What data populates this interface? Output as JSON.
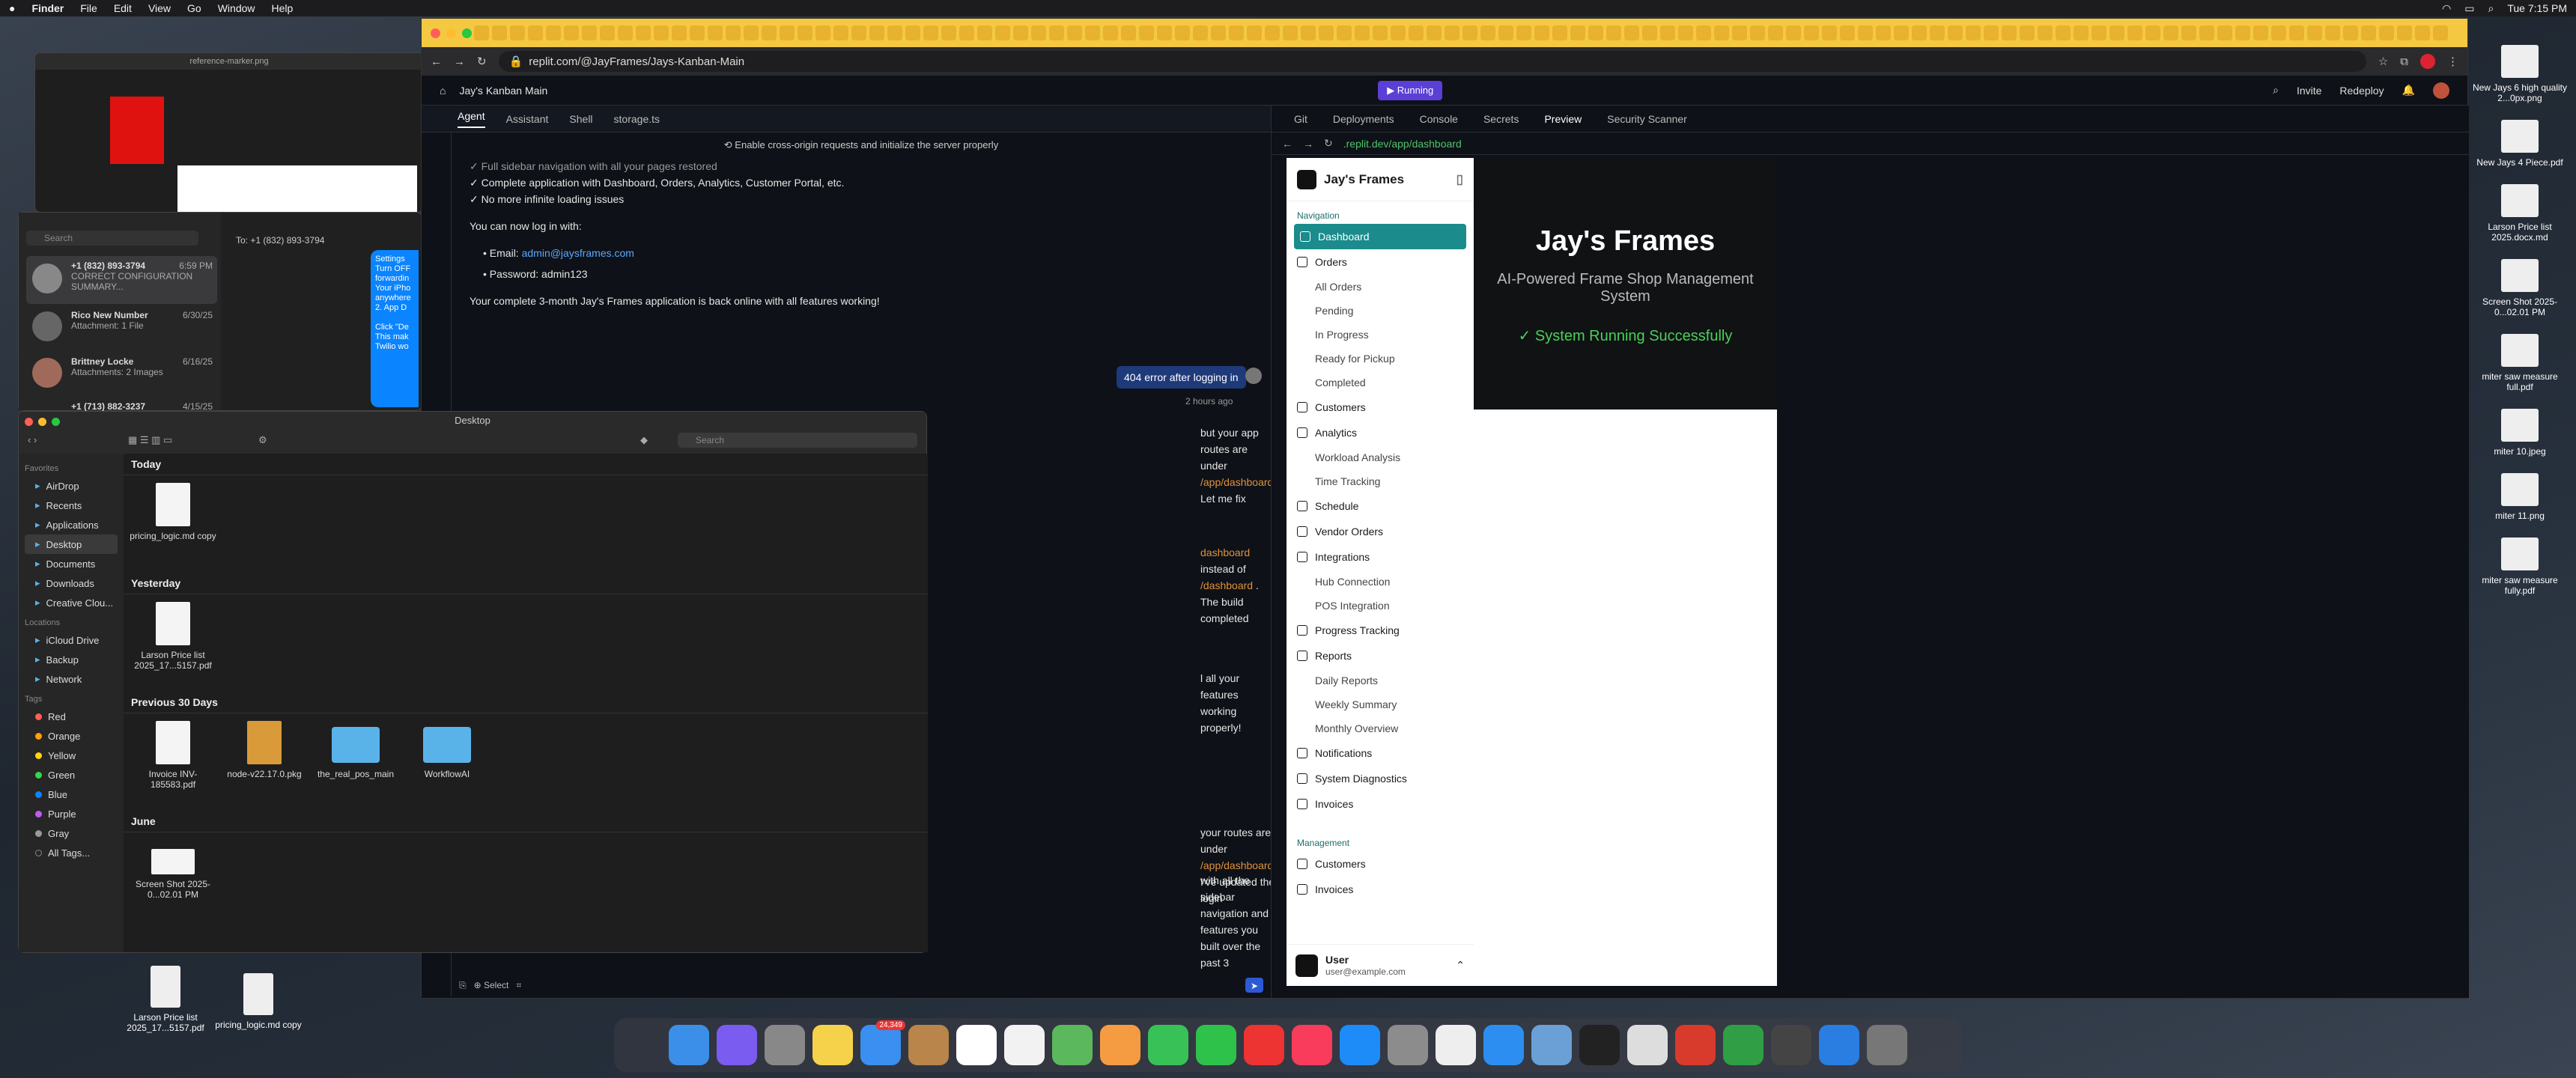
{
  "menubar": {
    "app": "Finder",
    "items": [
      "File",
      "Edit",
      "View",
      "Go",
      "Window",
      "Help"
    ],
    "clock": "Tue 7:15 PM"
  },
  "browser": {
    "url": "replit.com/@JayFrames/Jays-Kanban-Main",
    "repl_title": "Jay's Kanban Main",
    "status": "Running",
    "header_actions": [
      "Invite",
      "Redeploy"
    ],
    "left_tabs": [
      "Agent",
      "Assistant",
      "Shell",
      "storage.ts"
    ],
    "right_tabs": [
      "Git",
      "Deployments",
      "Console",
      "Secrets",
      "Preview",
      "Security Scanner"
    ],
    "preview_url": ".replit.dev/app/dashboard",
    "tab_count": "24,349"
  },
  "chat": {
    "checkpoint": "Enable cross-origin requests and initialize the server properly",
    "lines": [
      "✓ Full sidebar navigation with all your pages restored",
      "✓ Complete application with Dashboard, Orders, Analytics, Customer Portal, etc.",
      "✓ No more infinite loading issues",
      "You can now log in with:",
      "Password: admin123",
      "Your complete 3-month Jay's Frames application is back online with all features working!"
    ],
    "email_label": "Email:",
    "email": "admin@jaysframes.com",
    "user_msg": "404 error after logging in",
    "user_msg_time": "2 hours ago",
    "frag1": "but your app routes are under",
    "frag1_code": "/app/dashboard",
    "frag1_end": ". Let me fix",
    "frag2_code1": "dashboard",
    "frag2_mid": "instead of",
    "frag2_code2": "/dashboard",
    "frag2_end": ". The build completed",
    "frag3": "l all your features working properly!",
    "frag4": "your routes are under",
    "frag4_code": "/app/dashboard",
    "frag4_end": ". I've updated the login",
    "frag5": "with all the sidebar navigation and features you built over the past 3",
    "select_label": "Select"
  },
  "app": {
    "brand": "Jay's Frames",
    "hero_title": "Jay's Frames",
    "hero_sub": "AI-Powered Frame Shop Management System",
    "hero_status": "✓ System Running Successfully",
    "nav_heading": "Navigation",
    "nav": [
      {
        "label": "Dashboard",
        "level": 0,
        "active": true
      },
      {
        "label": "Orders",
        "level": 0
      },
      {
        "label": "All Orders",
        "level": 1
      },
      {
        "label": "Pending",
        "level": 1
      },
      {
        "label": "In Progress",
        "level": 1
      },
      {
        "label": "Ready for Pickup",
        "level": 1
      },
      {
        "label": "Completed",
        "level": 1
      },
      {
        "label": "Customers",
        "level": 0
      },
      {
        "label": "Analytics",
        "level": 0
      },
      {
        "label": "Workload Analysis",
        "level": 1
      },
      {
        "label": "Time Tracking",
        "level": 1
      },
      {
        "label": "Schedule",
        "level": 0
      },
      {
        "label": "Vendor Orders",
        "level": 0
      },
      {
        "label": "Integrations",
        "level": 0
      },
      {
        "label": "Hub Connection",
        "level": 1
      },
      {
        "label": "POS Integration",
        "level": 1
      },
      {
        "label": "Progress Tracking",
        "level": 0
      },
      {
        "label": "Reports",
        "level": 0
      },
      {
        "label": "Daily Reports",
        "level": 1
      },
      {
        "label": "Weekly Summary",
        "level": 1
      },
      {
        "label": "Monthly Overview",
        "level": 1
      },
      {
        "label": "Notifications",
        "level": 0
      },
      {
        "label": "System Diagnostics",
        "level": 0
      },
      {
        "label": "Invoices",
        "level": 0
      }
    ],
    "mgmt_heading": "Management",
    "mgmt": [
      "Customers",
      "Invoices"
    ],
    "user_name": "User",
    "user_email": "user@example.com"
  },
  "finder": {
    "title": "Desktop",
    "search_placeholder": "Search",
    "favorites_heading": "Favorites",
    "favorites": [
      "AirDrop",
      "Recents",
      "Applications",
      "Desktop",
      "Documents",
      "Downloads",
      "Creative Clou..."
    ],
    "locations_heading": "Locations",
    "locations": [
      "iCloud Drive",
      "Backup",
      "Network"
    ],
    "tags_heading": "Tags",
    "tags": [
      {
        "label": "Red",
        "color": "#ff5f57"
      },
      {
        "label": "Orange",
        "color": "#ff9f0a"
      },
      {
        "label": "Yellow",
        "color": "#ffd60a"
      },
      {
        "label": "Green",
        "color": "#32d74b"
      },
      {
        "label": "Blue",
        "color": "#0a84ff"
      },
      {
        "label": "Purple",
        "color": "#bf5af2"
      },
      {
        "label": "Gray",
        "color": "#98989d"
      },
      {
        "label": "All Tags...",
        "color": ""
      }
    ],
    "sections": [
      {
        "title": "Today",
        "files": [
          {
            "name": "pricing_logic.md copy",
            "kind": "doc"
          }
        ]
      },
      {
        "title": "Yesterday",
        "files": [
          {
            "name": "Larson Price list 2025_17...5157.pdf",
            "kind": "doc"
          }
        ]
      },
      {
        "title": "Previous 30 Days",
        "files": [
          {
            "name": "Invoice INV-185583.pdf",
            "kind": "doc"
          },
          {
            "name": "node-v22.17.0.pkg",
            "kind": "pkg"
          },
          {
            "name": "the_real_pos_main",
            "kind": "folder"
          },
          {
            "name": "WorkflowAI",
            "kind": "folder"
          }
        ]
      },
      {
        "title": "June",
        "files": [
          {
            "name": "Screen Shot 2025-0...02.01 PM",
            "kind": "shot"
          }
        ]
      }
    ]
  },
  "messages": {
    "search_placeholder": "Search",
    "to": "To:  +1 (832) 893-3794",
    "threads": [
      {
        "name": "+1 (832) 893-3794",
        "time": "6:59 PM",
        "preview": "CORRECT CONFIGURATION SUMMARY..."
      },
      {
        "name": "Rico New Number",
        "time": "6/30/25",
        "preview": "Attachment: 1 File"
      },
      {
        "name": "Brittney Locke",
        "time": "6/16/25",
        "preview": "Attachments: 2 Images"
      },
      {
        "name": "+1 (713) 882-3237",
        "time": "4/15/25",
        "preview": ""
      }
    ],
    "bubble": "Settings\nTurn OFF\nforwardin\nYour iPho\nanywhere\n2. App D\n\nClick \"De\nThis mak\nTwilio wo"
  },
  "preview_window": {
    "title": "reference-marker.png"
  },
  "desktop_files": [
    {
      "name": "New Jays 6 high quality 2...0px.png"
    },
    {
      "name": "New Jays 4 Piece.pdf"
    },
    {
      "name": "Larson Price list 2025.docx.md"
    },
    {
      "name": "Screen Shot 2025-0...02.01 PM"
    },
    {
      "name": "miter saw measure full.pdf"
    },
    {
      "name": "miter 10.jpeg"
    },
    {
      "name": "miter 11.png"
    },
    {
      "name": "miter saw measure fully.pdf"
    }
  ],
  "desktop_left_files": [
    {
      "name": "Larson Price list 2025_17...5157.pdf"
    },
    {
      "name": "pricing_logic.md copy"
    }
  ]
}
